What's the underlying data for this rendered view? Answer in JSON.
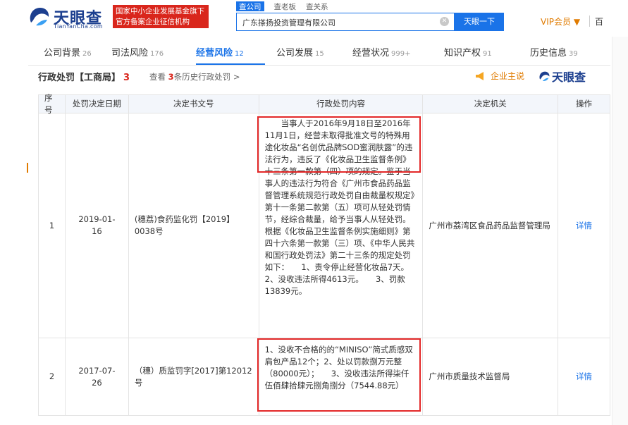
{
  "header": {
    "logo_text": "天眼查",
    "logo_sub": "TianYanCha.com",
    "slogan_line1": "国家中小企业发展基金旗下",
    "slogan_line2": "官方备案企业征信机构",
    "search_tabs": [
      "查公司",
      "查老板",
      "查关系"
    ],
    "search_value": "广东搽扬投资管理有限公司",
    "search_button": "天眼一下",
    "vip_label": "VIP会员",
    "more_label": "百"
  },
  "nav": {
    "tabs": [
      {
        "label": "公司背景",
        "count": "26"
      },
      {
        "label": "司法风险",
        "count": "176"
      },
      {
        "label": "经营风险",
        "count": "12"
      },
      {
        "label": "公司发展",
        "count": "15"
      },
      {
        "label": "经营状况",
        "count": "999+"
      },
      {
        "label": "知识产权",
        "count": "91"
      },
      {
        "label": "历史信息",
        "count": "39"
      }
    ]
  },
  "section": {
    "title": "行政处罚【工商局】",
    "count": "3",
    "history_prefix": "查看",
    "history_num": "3",
    "history_suffix": "条历史行政处罚 >",
    "owner_label": "企业主说",
    "brand_label": "天眼查"
  },
  "table": {
    "headers": [
      "序号",
      "处罚决定日期",
      "决定书文号",
      "行政处罚内容",
      "决定机关",
      "操作"
    ],
    "rows": [
      {
        "idx": "1",
        "date": "2019-01-\n16",
        "doc": "(穗荔)食药监化罚【2019】0038号",
        "content": "　　当事人于2016年9月18日至2016年11月1日，经营未取得批准文号的特殊用途化妆品“名创优品牌SOD蜜润肤露”的违法行为，违反了《化妆品卫生监督条例》十三条第一款第（四）项的规定。鉴于当事人的违法行为符合《广州市食品药品监督管理系统规范行政处罚自由裁量权规定》第十一条第二款第（五）项可从轻处罚情节，经综合裁量，给予当事人从轻处罚。根据《化妆品卫生监督条例实施细则》第四十六条第一款第（三）项、《中华人民共和国行政处罚法》第二十三条的规定处罚如下：　　1、责令停止经营化妆品7天。　　2、没收违法所得4613元。　　3、罚款13839元。",
        "org": "广州市荔湾区食品药品监督管理局",
        "op": "详情"
      },
      {
        "idx": "2",
        "date": "2017-07-\n26",
        "doc": "（穗）质监罚字[2017]第12012号",
        "content": "1、没收不合格的的“MINISO”简式质感双肩包产品12个；2、处以罚款捌万元整（80000元）；　　3、没收违法所得柒仟伍佰肆拾肆元捌角捌分（7544.88元）",
        "org": "广州市质量技术监督局",
        "op": "详情"
      }
    ]
  },
  "colors": {
    "brand_blue": "#1a73e8",
    "highlight_red": "#e32828",
    "vip_orange": "#e07b00"
  }
}
